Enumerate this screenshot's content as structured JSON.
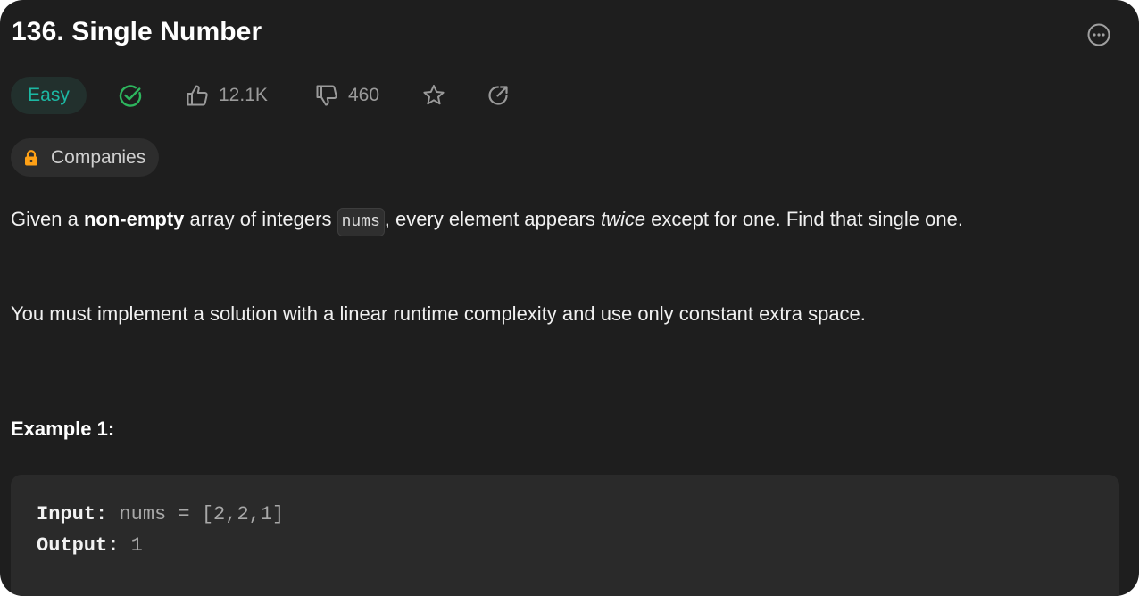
{
  "problem": {
    "title": "136. Single Number",
    "difficulty": "Easy",
    "likes": "12.1K",
    "dislikes": "460",
    "companies_label": "Companies"
  },
  "description": {
    "p1": {
      "part1": "Given a ",
      "bold": "non-empty",
      "part2": " array of integers ",
      "code": "nums",
      "part3": ", every element appears ",
      "italic": "twice",
      "part4": " except for one. Find that single one."
    },
    "p2": "You must implement a solution with a linear runtime complexity and use only constant extra space."
  },
  "example": {
    "title": "Example 1:",
    "input_label": "Input:",
    "input_value": " nums = [2,2,1]",
    "output_label": "Output:",
    "output_value": " 1"
  },
  "icons": {
    "more": "more-horizontal-circle-icon",
    "solved": "check-circle-icon",
    "like": "thumbs-up-icon",
    "dislike": "thumbs-down-icon",
    "favorite": "star-icon",
    "share": "share-arrow-icon",
    "lock": "lock-icon"
  },
  "colors": {
    "background": "#1e1e1e",
    "easy_text": "#1cb8a3",
    "easy_bg": "#22302d",
    "solved": "#2db55d",
    "lock": "#ffa116"
  }
}
